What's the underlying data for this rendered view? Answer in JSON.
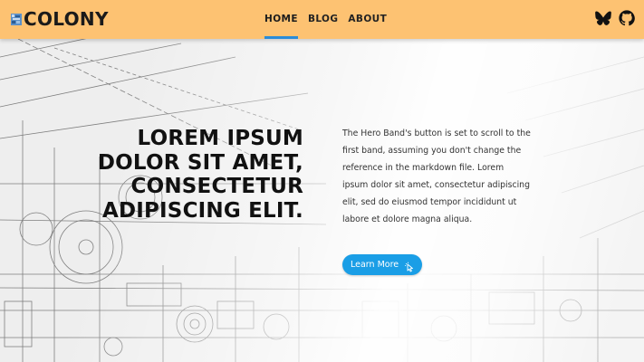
{
  "header": {
    "logo_text": "COLONY",
    "nav": [
      {
        "label": "HOME",
        "active": true
      },
      {
        "label": "BLOG",
        "active": false
      },
      {
        "label": "ABOUT",
        "active": false
      }
    ],
    "social_icons": [
      "bluesky-icon",
      "github-icon"
    ]
  },
  "hero": {
    "headline": "LOREM IPSUM DOLOR SIT AMET, CONSECTETUR ADIPISCING ELIT.",
    "copy": "The Hero Band's button is set to scroll to the first band, assuming you don't change the reference in the markdown file. Lorem ipsum dolor sit amet, consectetur adipiscing elit, sed do eiusmod tempor incididunt ut labore et dolore magna aliqua.",
    "button_label": "Learn More"
  },
  "colors": {
    "header_bg": "#fdc272",
    "accent": "#1a9ee6",
    "nav_underline": "#2a8bd8"
  }
}
